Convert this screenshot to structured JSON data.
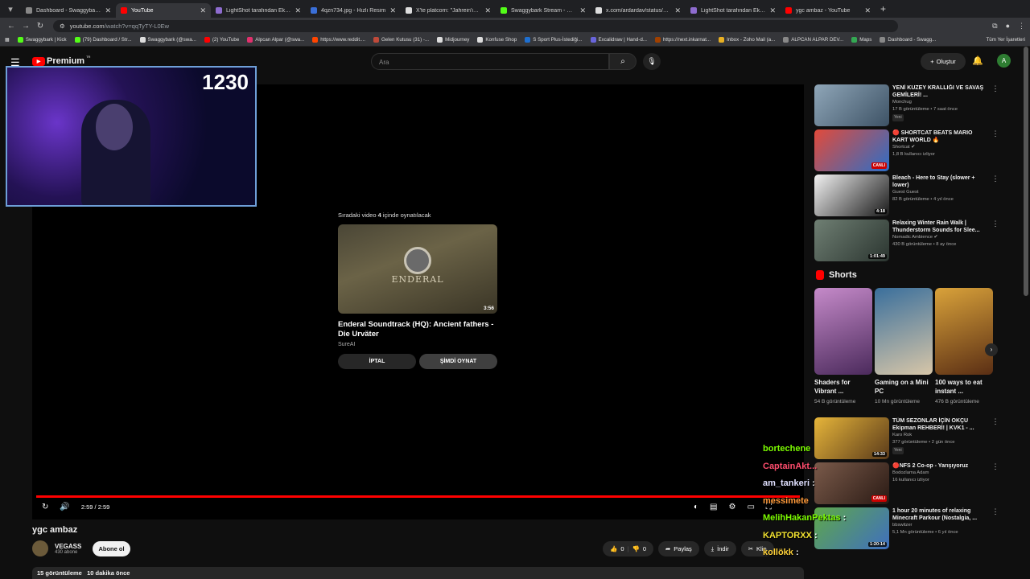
{
  "browser": {
    "tabs": [
      {
        "title": "Dashboard - Swaggybark Link",
        "color": "#888888",
        "active": false
      },
      {
        "title": "YouTube",
        "color": "#ff0000",
        "active": true
      },
      {
        "title": "LightShot tarafından Ekran Gör",
        "color": "#8e6ccf",
        "active": false
      },
      {
        "title": "4qzn734.jpg - Hızlı Resim",
        "color": "#3a6fd8",
        "active": false
      },
      {
        "title": "X'te platcorn: \"Jahrein'in kişisi",
        "color": "#dddddd",
        "active": false
      },
      {
        "title": "Swaggybark Stream - Watch Li",
        "color": "#53fc18",
        "active": false
      },
      {
        "title": "x.com/ardardav/status/19774",
        "color": "#dddddd",
        "active": false
      },
      {
        "title": "LightShot tarafından Ekran Gö",
        "color": "#8e6ccf",
        "active": false
      },
      {
        "title": "ygc ambaz - YouTube",
        "color": "#ff0000",
        "active": false
      }
    ],
    "url": "youtube.com",
    "url_path": "/watch?v=qqTyTY-L0Ew",
    "bookmarks": [
      {
        "label": "Swaggybark | Kick",
        "color": "#53fc18"
      },
      {
        "label": "(79) Dashboard / Str...",
        "color": "#53fc18"
      },
      {
        "label": "Swaggybark (@swa...",
        "color": "#dddddd"
      },
      {
        "label": "(2) YouTube",
        "color": "#ff0000"
      },
      {
        "label": "Alpcan Alpar (@swa...",
        "color": "#e1306c"
      },
      {
        "label": "https://www.reddit....",
        "color": "#ff4500"
      },
      {
        "label": "Gelen Kutusu (31) -...",
        "color": "#c04a3a"
      },
      {
        "label": "Midjourney",
        "color": "#dddddd"
      },
      {
        "label": "Konfuse Shop",
        "color": "#dddddd"
      },
      {
        "label": "S Sport Plus-İstediği...",
        "color": "#1e6fd0"
      },
      {
        "label": "Excalidraw | Hand-d...",
        "color": "#6965db"
      },
      {
        "label": "https://next.inkarnat...",
        "color": "#a04000"
      },
      {
        "label": "Inbox - Zoho Mail (a...",
        "color": "#e8b023"
      },
      {
        "label": "ALPCAN ALPAR DEV...",
        "color": "#888888"
      },
      {
        "label": "Maps",
        "color": "#34a853"
      },
      {
        "label": "Dashboard - Swagg...",
        "color": "#888888"
      }
    ],
    "bookmarks_all": "Tüm Yer İşaretleri"
  },
  "youtube": {
    "logo_text": "Premium",
    "logo_region": "TR",
    "search_placeholder": "Ara",
    "create_label": "Oluştur",
    "avatar_letter": "A"
  },
  "player": {
    "up_next_prefix": "Sıradaki video",
    "up_next_count": "4",
    "up_next_suffix": "içinde oynatılacak",
    "next_video": {
      "title": "Enderal Soundtrack (HQ): Ancient fathers - Die Urväter",
      "channel": "SureAI",
      "duration": "3:56",
      "thumb_text": "ENDERAL"
    },
    "cancel_label": "İPTAL",
    "play_now_label": "ŞİMDİ OYNAT",
    "time": "2:59 / 2:59",
    "progress": 1.0
  },
  "webcam_overlay": {
    "counter": "1230"
  },
  "video": {
    "title": "ygc ambaz",
    "channel": "VEGASS",
    "subscribers": "430 abone",
    "subscribe_label": "Abone ol",
    "likes": "0",
    "dislikes": "0",
    "share_label": "Paylaş",
    "download_label": "İndir",
    "clip_label": "Klip",
    "views": "15 görüntüleme",
    "age": "10 dakika önce"
  },
  "recommended_top": [
    {
      "title": "YENİ KUZEY KRALLIĞI VE SAVAŞ GEMİLERİ! ...",
      "channel": "Monchug",
      "meta": "17 B görüntüleme • 7 saat önce",
      "badge": "Yeni",
      "duration": "",
      "live": "",
      "c1": "#8fa6b8",
      "c2": "#3d5265"
    },
    {
      "title": "🔴 SHORTCAT BEATS MARIO KART WORLD 🔥",
      "channel": "Shortcat ✔",
      "meta": "1,8 B kullanıcı izliyor",
      "badge": "",
      "duration": "",
      "live": "CANLI",
      "c1": "#e24a3a",
      "c2": "#2d6ec7"
    },
    {
      "title": "Bleach - Here to Stay (slower + lower)",
      "channel": "Guest Guest",
      "meta": "82 B görüntüleme • 4 yıl önce",
      "badge": "",
      "duration": "4:18",
      "live": "",
      "c1": "#f2f2f2",
      "c2": "#1a1a1a"
    },
    {
      "title": "Relaxing Winter Rain Walk | Thunderstorm Sounds for Slee...",
      "channel": "Nomadic Ambience ✔",
      "meta": "430 B görüntüleme • 8 ay önce",
      "badge": "",
      "duration": "1:01:49",
      "live": "",
      "c1": "#6f7f73",
      "c2": "#2b3530"
    }
  ],
  "shorts": {
    "heading": "Shorts",
    "items": [
      {
        "title": "Shaders for Vibrant ...",
        "views": "54 B görüntüleme",
        "c1": "#c58ac9",
        "c2": "#4b2a5c"
      },
      {
        "title": "Gaming on a Mini PC",
        "views": "10 Mn görüntüleme",
        "c1": "#3a6f9c",
        "c2": "#d7c6a8"
      },
      {
        "title": "100 ways to eat instant ...",
        "views": "476 B görüntüleme",
        "c1": "#d9a23a",
        "c2": "#5a2e14"
      }
    ]
  },
  "recommended_bottom": [
    {
      "title": "TÜM SEZONLAR İÇİN OKÇU Ekipman REHBERİ! | KVK1 - ...",
      "channel": "Karo Rok",
      "meta": "377 görüntüleme • 2 gün önce",
      "badge": "Yeni",
      "duration": "14:33",
      "live": "",
      "c1": "#e6b53a",
      "c2": "#5a3a1a"
    },
    {
      "title": "🔴NFS 2 Co-op - Yarışıyoruz",
      "channel": "Bodozlama Adam",
      "meta": "16 kullanıcı izliyor",
      "badge": "",
      "duration": "",
      "live": "CANLI",
      "c1": "#7a5a4a",
      "c2": "#2a1a14"
    },
    {
      "title": "1 hour 20 minutes of relaxing Minecraft Parkour (Nostalgia, ...",
      "channel": "bbswitzer",
      "meta": "5,1 Mn görüntüleme • 6 yıl önce",
      "badge": "",
      "duration": "1:20:14",
      "live": "",
      "c1": "#5fa84a",
      "c2": "#3f6fbf"
    }
  ],
  "chat_overlay": [
    {
      "name": "bortechene",
      "text": "",
      "color": "#7cfc00"
    },
    {
      "name": "CaptainAkt...",
      "text": "",
      "color": "#ff4d6d"
    },
    {
      "name": "am_tankeri",
      "text": ":",
      "color": "#e0e0ff"
    },
    {
      "name": "messimete",
      "text": "",
      "color": "#ff9a3a"
    },
    {
      "name": "MelihHakanPektas",
      "text": ":",
      "color": "#7cfc00"
    },
    {
      "name": "KAPTORXX",
      "text": ":",
      "color": "#f0e030"
    },
    {
      "name": "kollökk",
      "text": ":",
      "color": "#ffd23a"
    }
  ]
}
